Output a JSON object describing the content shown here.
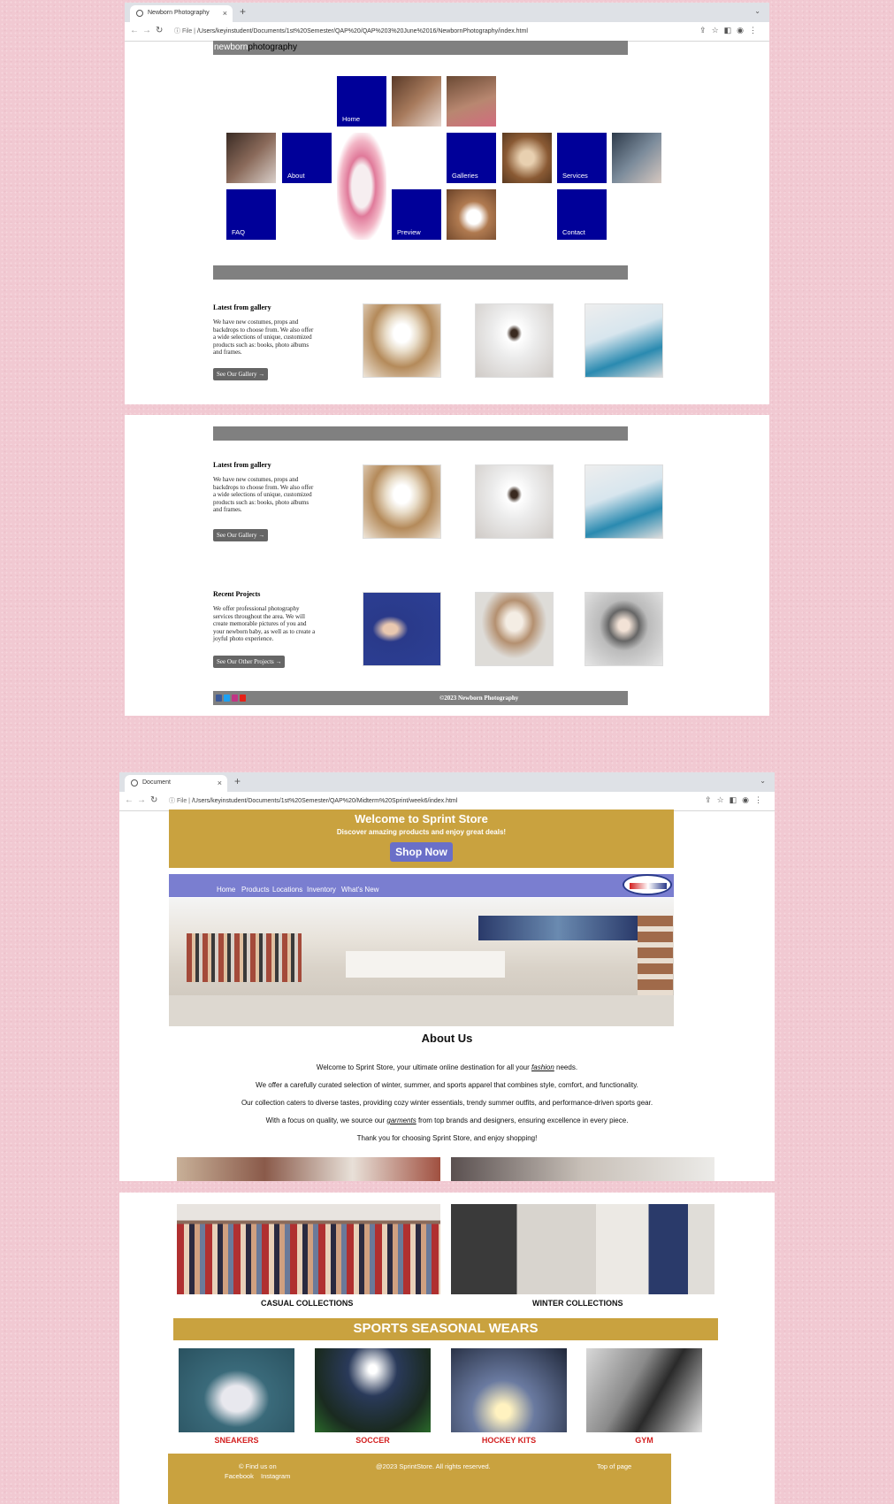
{
  "window1": {
    "tab_title": "Newborn Photography",
    "url_prefix": "File",
    "url": "/Users/keyinstudent/Documents/1st%20Semester/QAP%20/QAP%203%20June%2016/NewbornPhotography/index.html",
    "logo_part1": "newborn",
    "logo_part2": "photography",
    "nav": {
      "home": "Home",
      "about": "About",
      "galleries": "Galleries",
      "services": "Services",
      "faq": "FAQ",
      "preview": "Preview",
      "contact": "Contact"
    },
    "latest": {
      "title": "Latest from gallery",
      "text": "We have new costumes, props and backdrops to choose from. We also offer a wide selections of unique, customized products such as: books, photo albums and frames.",
      "button": "See Our Gallery →"
    }
  },
  "window2": {
    "latest": {
      "title": "Latest from gallery",
      "text": "We have new costumes, props and backdrops to choose from. We also offer a wide selections of unique, customized products such as: books, photo albums and frames.",
      "button": "See Our Gallery →"
    },
    "recent": {
      "title": "Recent Projects",
      "text": "We offer professional photography services throughout the area. We will create memorable pictures of you and your newborn baby, as well as to create a joyful photo experience.",
      "button": "See Our Other Projects →"
    },
    "footer": "©2023 Newborn Photography"
  },
  "window3": {
    "tab_title": "Document",
    "url_prefix": "File",
    "url": "/Users/keyinstudent/Documents/1st%20Semester/QAP%20/Midterm%20Sprint/week6/index.html",
    "header": {
      "title": "Welcome to Sprint Store",
      "subtitle": "Discover amazing products and enjoy great deals!",
      "cta": "Shop Now"
    },
    "nav": [
      "Home",
      "Products",
      "Locations",
      "Inventory",
      "What's New"
    ],
    "about": {
      "title": "About Us",
      "p1_pre": "Welcome to Sprint Store, your ultimate online destination for all your ",
      "p1_em": "fashion",
      "p1_post": " needs.",
      "p2": "We offer a carefully curated selection of winter, summer, and sports apparel that combines style, comfort, and functionality.",
      "p3": "Our collection caters to diverse tastes, providing cozy winter essentials, trendy summer outfits, and performance-driven sports gear.",
      "p4_pre": "With a focus on quality, we source our ",
      "p4_em": "garments",
      "p4_post": " from top brands and designers, ensuring excellence in every piece.",
      "p5": "Thank you for choosing Sprint Store, and enjoy shopping!"
    }
  },
  "window4": {
    "collections": [
      "CASUAL COLLECTIONS",
      "WINTER COLLECTIONS"
    ],
    "sports_title": "SPORTS SEASONAL WEARS",
    "sports": [
      "SNEAKERS",
      "SOCCER",
      "HOCKEY KITS",
      "GYM"
    ],
    "footer": {
      "find": "© Find us on",
      "facebook": "Facebook",
      "instagram": "Instagram",
      "copyright": "@2023 SprintStore. All rights reserved.",
      "top": "Top of page"
    }
  },
  "colors": {
    "newborn_tile": "#000099",
    "newborn_bar": "#808080",
    "sprint_gold": "#c9a23f",
    "sprint_nav": "#7a7ed0",
    "sport_label": "#d32020",
    "background": "#f1c9d2"
  }
}
